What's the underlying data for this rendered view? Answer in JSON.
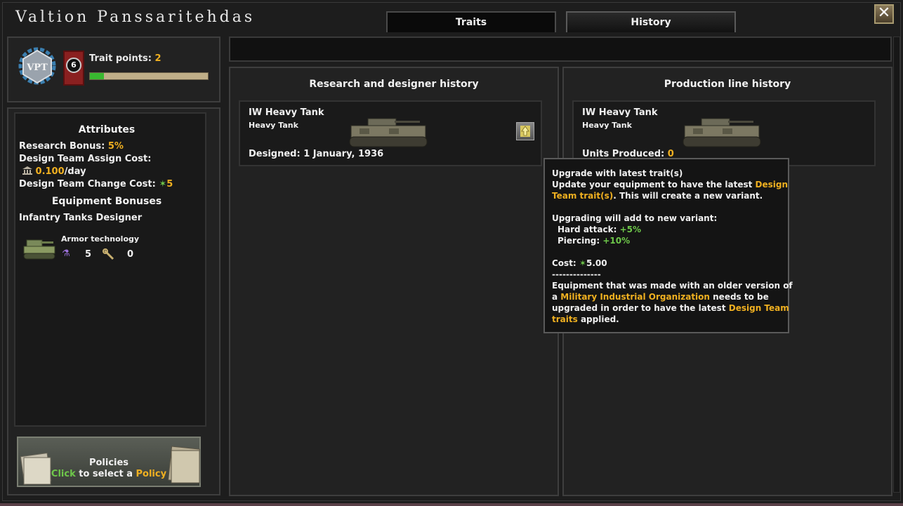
{
  "window": {
    "title": "Valtion Panssaritehdas",
    "close_symbol": "✕"
  },
  "tabs": [
    {
      "label": "Traits",
      "active": false
    },
    {
      "label": "History",
      "active": true
    }
  ],
  "organization": {
    "logo_text": "VPT",
    "trait_count": "6",
    "trait_points_label": "Trait points:",
    "trait_points_value": "2",
    "trait_progress": 0.12
  },
  "attributes": {
    "title": "Attributes",
    "research_bonus_label": "Research Bonus:",
    "research_bonus_value": "5%",
    "assign_cost_label": "Design Team Assign Cost:",
    "assign_cost_value": "0.100",
    "assign_cost_unit": "/day",
    "change_cost_label": "Design Team Change Cost:",
    "change_cost_value": "5"
  },
  "equipment_bonuses": {
    "title": "Equipment Bonuses",
    "designer_type": "Infantry Tanks Designer",
    "technology_label": "Armor technology",
    "research_value": "5",
    "production_value": "0"
  },
  "policies": {
    "title": "Policies",
    "click_word": "Click",
    "middle_text": "to select a",
    "policy_word": "Policy"
  },
  "research_history": {
    "title": "Research and designer history",
    "item": {
      "name": "IW Heavy Tank",
      "type": "Heavy Tank",
      "designed": "Designed: 1 January, 1936"
    }
  },
  "production_history": {
    "title": "Production line history",
    "item": {
      "name": "IW Heavy Tank",
      "type": "Heavy Tank",
      "units_label": "Units Produced:",
      "units_value": "0"
    }
  },
  "tooltip": {
    "title": "Upgrade with latest trait(s)",
    "line1_a": "Update your equipment to have the latest",
    "line1_b": "Design",
    "line2_a": "Team trait(s)",
    "line2_b": ". This will create a new variant.",
    "upgrade_heading": "Upgrading will add to new variant:",
    "hard_attack_label": "Hard attack:",
    "hard_attack_value": "+5%",
    "piercing_label": "Piercing:",
    "piercing_value": "+10%",
    "cost_label": "Cost:",
    "cost_value": "5.00",
    "separator": "--------------",
    "p1": "Equipment that was made with an older version of",
    "p2_a": "a",
    "p2_b": "Military Industrial Organization",
    "p2_c": "needs to be",
    "p3_a": "upgraded in order to have the latest",
    "p3_b": "Design Team",
    "p4_a": "traits",
    "p4_b": "applied."
  },
  "colors": {
    "highlight": "#f0b020",
    "positive": "#6ec84a"
  }
}
